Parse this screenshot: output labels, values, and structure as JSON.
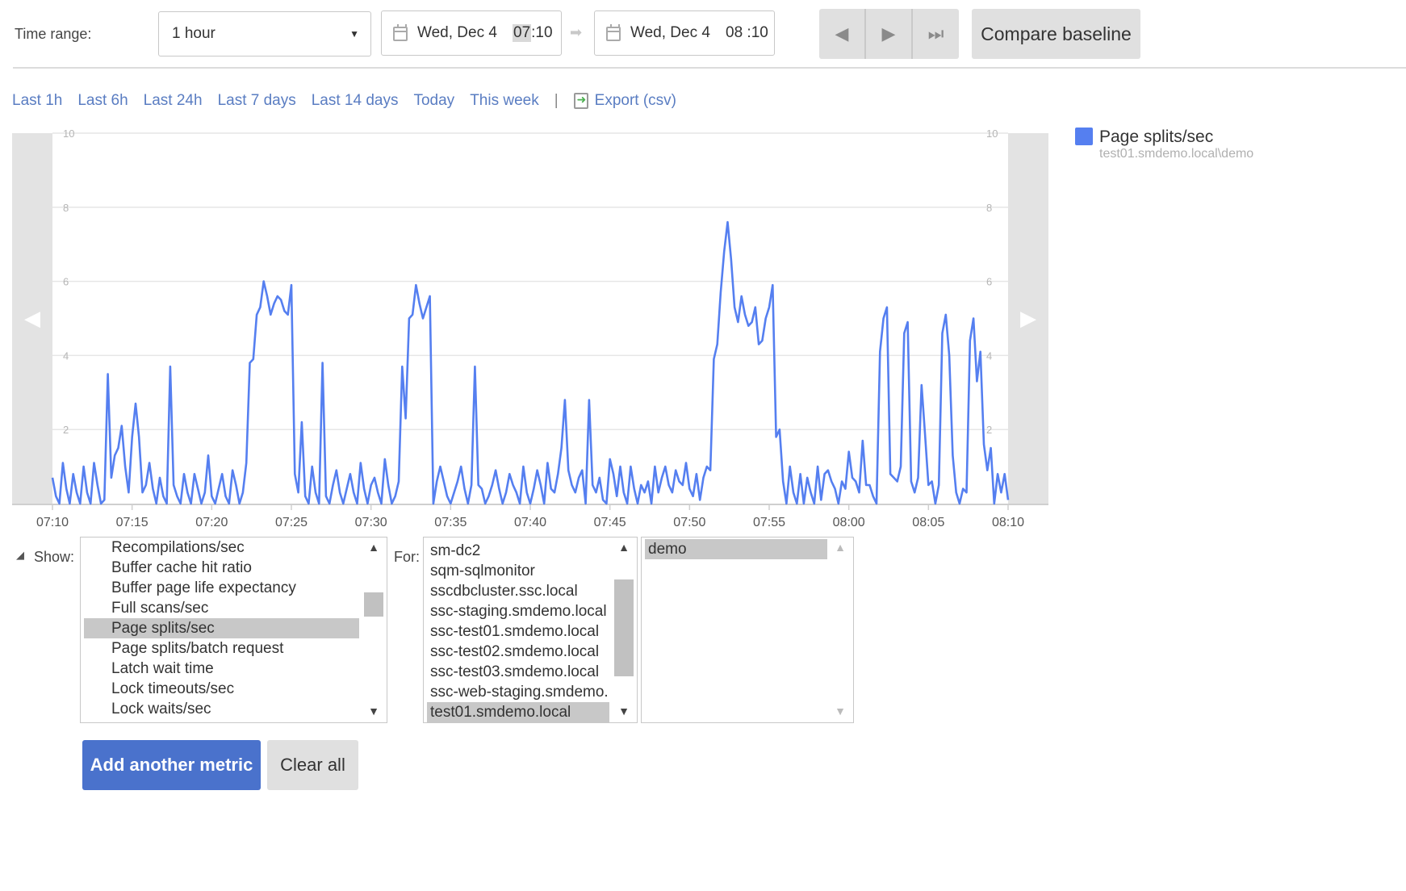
{
  "toolbar": {
    "time_range_label": "Time range:",
    "time_range_value": "1 hour",
    "start_date": "Wed, Dec 4",
    "start_hour": "07",
    "start_min": ":10",
    "end_date": "Wed, Dec 4",
    "end_time": "08 :10",
    "compare_label": "Compare baseline"
  },
  "quick_ranges": [
    "Last 1h",
    "Last 6h",
    "Last 24h",
    "Last 7 days",
    "Last 14 days",
    "Today",
    "This week"
  ],
  "export_label": "Export (csv)",
  "chart_data": {
    "type": "line",
    "series": [
      {
        "name": "Page splits/sec",
        "sub": "test01.smdemo.local\\demo",
        "color": "#557ff0",
        "values": [
          0.7,
          0.2,
          0,
          1.1,
          0.4,
          0,
          0.8,
          0.3,
          0,
          1,
          0.3,
          0,
          1.1,
          0.5,
          0,
          0.1,
          3.5,
          0.7,
          1.3,
          1.5,
          2.1,
          1,
          0.3,
          1.8,
          2.7,
          1.8,
          0.3,
          0.5,
          1.1,
          0.4,
          0,
          0.7,
          0.2,
          0,
          3.7,
          0.5,
          0.2,
          0,
          0.8,
          0.3,
          0,
          0.8,
          0.4,
          0,
          0.3,
          1.3,
          0.2,
          0,
          0.4,
          0.8,
          0.2,
          0,
          0.9,
          0.5,
          0,
          0.3,
          1.1,
          3.8,
          3.9,
          5.1,
          5.3,
          6,
          5.6,
          5.1,
          5.4,
          5.6,
          5.5,
          5.2,
          5.1,
          5.9,
          0.8,
          0.3,
          2.2,
          0.2,
          0,
          1,
          0.3,
          0,
          3.8,
          0.2,
          0,
          0.5,
          0.9,
          0.3,
          0,
          0.4,
          0.8,
          0.3,
          0,
          1.1,
          0.4,
          0,
          0.5,
          0.7,
          0.3,
          0,
          1.2,
          0.5,
          0,
          0.2,
          0.6,
          3.7,
          2.3,
          5,
          5.1,
          5.9,
          5.4,
          5,
          5.3,
          5.6,
          0,
          0.6,
          1,
          0.6,
          0.2,
          0,
          0.3,
          0.6,
          1,
          0.4,
          0,
          0.5,
          3.7,
          0.5,
          0.4,
          0,
          0.2,
          0.5,
          0.9,
          0.4,
          0,
          0.3,
          0.8,
          0.5,
          0.3,
          0,
          1,
          0.3,
          0,
          0.4,
          0.9,
          0.5,
          0,
          1.1,
          0.4,
          0.3,
          0.8,
          1.5,
          2.8,
          0.9,
          0.5,
          0.3,
          0.7,
          0.9,
          0,
          2.8,
          0.5,
          0.3,
          0.7,
          0.1,
          0,
          1.2,
          0.8,
          0.2,
          1,
          0.3,
          0,
          1,
          0.4,
          0,
          0.5,
          0.3,
          0.6,
          0,
          1,
          0.3,
          0.7,
          1,
          0.5,
          0.3,
          0.9,
          0.6,
          0.5,
          1.1,
          0.4,
          0.2,
          0.8,
          0.1,
          0.7,
          1,
          0.9,
          3.9,
          4.3,
          5.7,
          6.8,
          7.6,
          6.6,
          5.3,
          4.9,
          5.6,
          5.1,
          4.8,
          4.9,
          5.3,
          4.3,
          4.4,
          5,
          5.3,
          5.9,
          1.8,
          2,
          0.6,
          0,
          1,
          0.3,
          0,
          0.8,
          0,
          0.7,
          0.3,
          0,
          1,
          0.1,
          0.8,
          0.9,
          0.6,
          0.4,
          0,
          0.6,
          0.4,
          1.4,
          0.7,
          0.6,
          0.3,
          1.7,
          0.5,
          0.5,
          0.2,
          0,
          4.1,
          5,
          5.3,
          0.8,
          0.7,
          0.6,
          1,
          4.6,
          4.9,
          0.6,
          0.3,
          0.7,
          3.2,
          1.9,
          0.5,
          0.6,
          0,
          0.5,
          4.6,
          5.1,
          4,
          1.3,
          0.3,
          0,
          0.4,
          0.3,
          4.4,
          5,
          3.3,
          4.1,
          1.6,
          0.9,
          1.5,
          0,
          0.8,
          0.3,
          0.8,
          0.1
        ]
      }
    ],
    "x_ticks": [
      "07:10",
      "07:15",
      "07:20",
      "07:25",
      "07:30",
      "07:35",
      "07:40",
      "07:45",
      "07:50",
      "07:55",
      "08:00",
      "08:05",
      "08:10"
    ],
    "y_ticks": [
      "10",
      "8",
      "6",
      "4",
      "2"
    ],
    "ylim": [
      0,
      10
    ],
    "grid": true,
    "legend_position": "right"
  },
  "show": {
    "label": "Show:",
    "items": [
      "Recompilations/sec",
      "Buffer cache hit ratio",
      "Buffer page life expectancy",
      "Full scans/sec",
      "Page splits/sec",
      "Page splits/batch request",
      "Latch wait time",
      "Lock timeouts/sec",
      "Lock waits/sec"
    ],
    "selected": 4
  },
  "for_list": {
    "label": "For:",
    "items": [
      "sm-dc2",
      "sqm-sqlmonitor",
      "sscdbcluster.ssc.local",
      "ssc-staging.smdemo.local",
      "ssc-test01.smdemo.local",
      "ssc-test02.smdemo.local",
      "ssc-test03.smdemo.local",
      "ssc-web-staging.smdemo.local",
      "test01.smdemo.local"
    ],
    "selected": 8
  },
  "instance_list": {
    "items": [
      "demo"
    ],
    "selected": 0
  },
  "actions": {
    "add_metric": "Add another metric",
    "clear_all": "Clear all"
  }
}
